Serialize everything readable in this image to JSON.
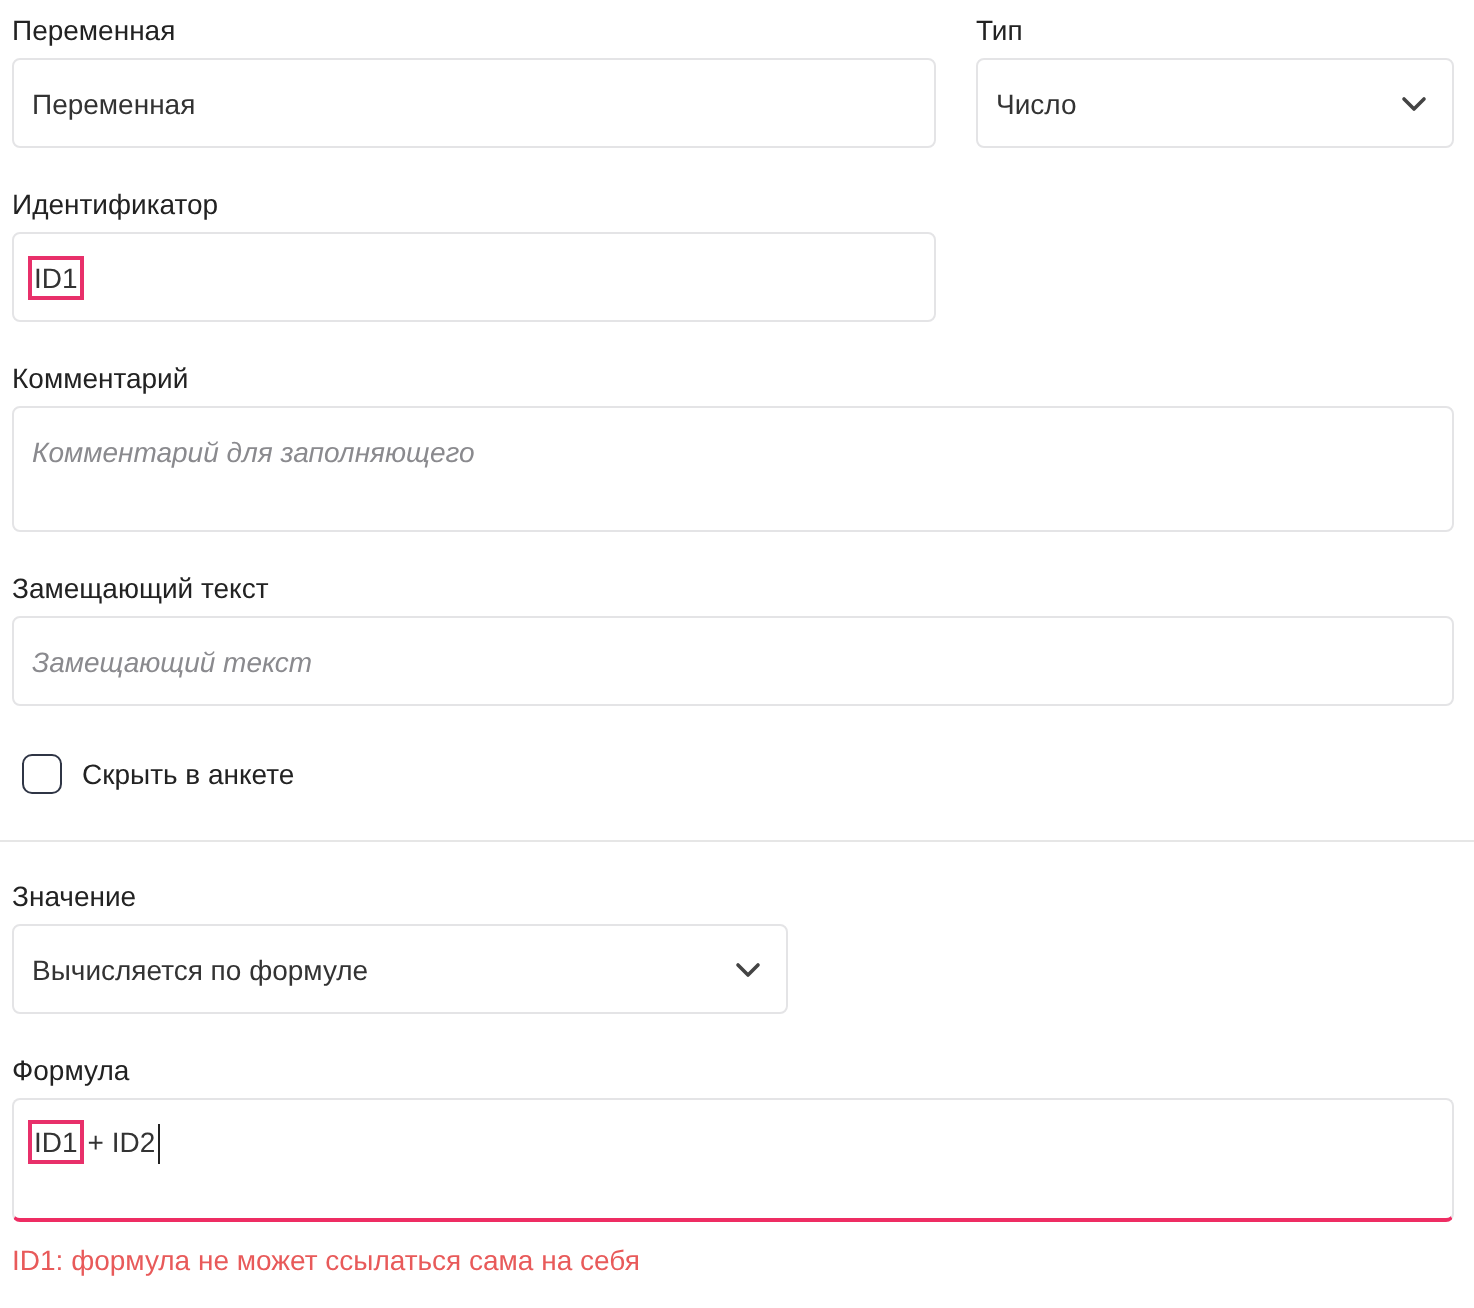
{
  "variable": {
    "label": "Переменная",
    "value": "Переменная"
  },
  "type": {
    "label": "Тип",
    "value": "Число"
  },
  "identifier": {
    "label": "Идентификатор",
    "tokens": [
      {
        "text": "ID1",
        "highlighted": true
      }
    ]
  },
  "comment": {
    "label": "Комментарий",
    "placeholder": "Комментарий для заполняющего"
  },
  "placeholder_text": {
    "label": "Замещающий текст",
    "placeholder": "Замещающий текст"
  },
  "hide_checkbox": {
    "label": "Скрыть в анкете",
    "checked": false
  },
  "value": {
    "label": "Значение",
    "value": "Вычисляется по формуле"
  },
  "formula": {
    "label": "Формула",
    "focused": true,
    "invalid": true,
    "tokens": [
      {
        "text": "ID1",
        "highlighted": true
      },
      {
        "text": "+ ID2",
        "highlighted": false
      }
    ],
    "error": "ID1: формула не может ссылаться сама на себя"
  }
}
